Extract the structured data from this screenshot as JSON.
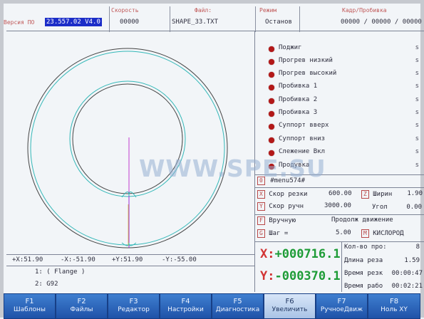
{
  "header": {
    "version_caption": "Версия ПО",
    "version_value": "23.557.02 V4.0",
    "speed_caption": "Скорость",
    "speed_value": "00000",
    "file_caption": "Файл:",
    "file_value": "SHAPE_33.TXT",
    "mode_caption": "Режим",
    "mode_value": "Останов",
    "frames_caption": "Кадр/Пробивка",
    "frames_value": "00000 / 00000 / 00000"
  },
  "lamps": [
    {
      "label": "Поджиг",
      "state": "s"
    },
    {
      "label": "Прогрев низкий",
      "state": "s"
    },
    {
      "label": "Прогрев высокий",
      "state": "s"
    },
    {
      "label": "Пробивка 1",
      "state": "s"
    },
    {
      "label": "Пробивка 2",
      "state": "s"
    },
    {
      "label": "Пробивка 3",
      "state": "s"
    },
    {
      "label": "Суппорт вверх",
      "state": "s"
    },
    {
      "label": "Суппорт вниз",
      "state": "s"
    },
    {
      "label": "Слежение Вкл",
      "state": "s"
    },
    {
      "label": "Продувка",
      "state": "s"
    }
  ],
  "lamp_color": "#b31818",
  "menu": {
    "key": "0",
    "text": "#menu574#"
  },
  "params": {
    "cut_speed_key": "X",
    "cut_speed_label": "Скор резки",
    "cut_speed_value": "600.00",
    "width_key": "Z",
    "width_label": "Ширин",
    "width_value": "1.90",
    "manual_speed_key": "Y",
    "manual_speed_label": "Скор ручн",
    "manual_speed_value": "3000.00",
    "angle_label": "Угол",
    "angle_value": "0.00",
    "manual_key": "F",
    "manual_label": "Вручную",
    "continuous_label": "Продолж движение",
    "step_key": "G",
    "step_label": "Шаг =",
    "step_value": "5.00",
    "gas_key": "M",
    "gas_label": "КИСЛОРОД"
  },
  "coords": {
    "x_label": "X:",
    "x_value": "+000716.1",
    "y_label": "Y:",
    "y_value": "-000370.1"
  },
  "stats": {
    "count_label": "Кол-во про:",
    "count_value": "8",
    "length_label": "Длина реза",
    "length_value": "1.59",
    "cut_time_label": "Время резк",
    "cut_time_value": "00:00:47",
    "work_time_label": "Время рабо",
    "work_time_value": "00:02:21"
  },
  "extents": {
    "xmax": "+X:51.90",
    "xmin": "-X:-51.90",
    "ymax": "+Y:51.90",
    "ymin": "-Y:-55.00"
  },
  "program_lines": [
    "1: ( Flange )",
    "2: G92"
  ],
  "fkeys": [
    {
      "key": "F1",
      "label": "Шаблоны"
    },
    {
      "key": "F2",
      "label": "Файлы"
    },
    {
      "key": "F3",
      "label": "Редактор"
    },
    {
      "key": "F4",
      "label": "Настройки"
    },
    {
      "key": "F5",
      "label": "Диагностика"
    },
    {
      "key": "F6",
      "label": "Увеличить"
    },
    {
      "key": "F7",
      "label": "РучноеДвиж"
    },
    {
      "key": "F8",
      "label": "Ноль XY"
    }
  ],
  "watermark": "WWW.SPE.SU",
  "colors": {
    "coord_green": "#1e9c37",
    "fkey_blue": "#2a64bd",
    "caption_red": "#c05858"
  }
}
